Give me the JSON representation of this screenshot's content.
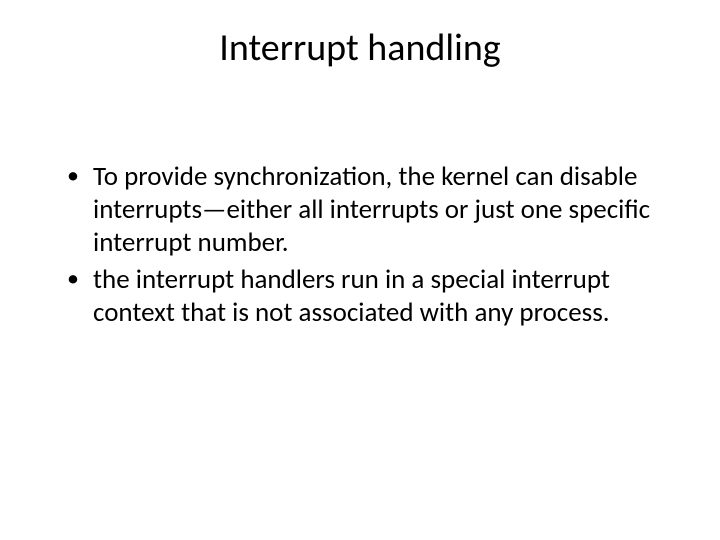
{
  "slide": {
    "title": "Interrupt handling",
    "bullets": [
      " To provide synchronization, the kernel can disable interrupts—either all interrupts or just one specific interrupt number.",
      " the interrupt handlers run in a special interrupt context  that is not associated with any process."
    ]
  }
}
